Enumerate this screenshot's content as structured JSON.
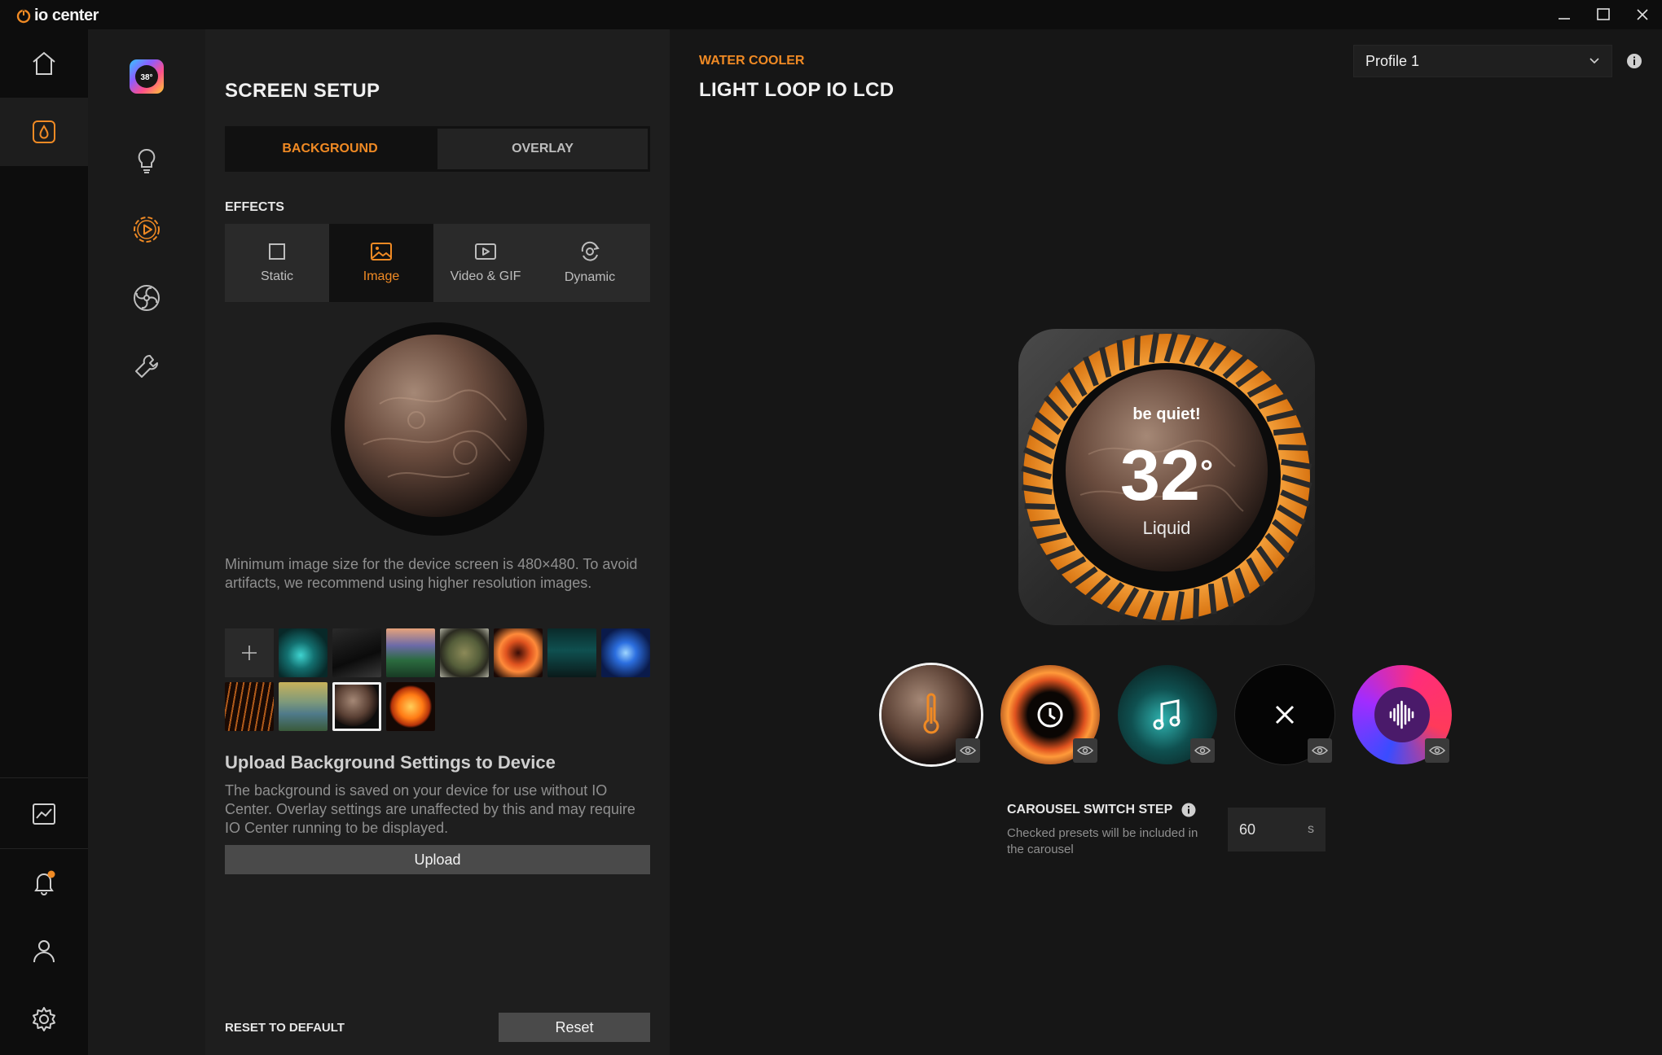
{
  "app": {
    "title": "io center"
  },
  "device": {
    "category": "WATER COOLER",
    "name": "LIGHT LOOP IO LCD"
  },
  "profile": {
    "selected": "Profile 1"
  },
  "panel": {
    "title": "SCREEN SETUP",
    "tabs": [
      {
        "label": "BACKGROUND",
        "active": true
      },
      {
        "label": "OVERLAY",
        "active": false
      }
    ],
    "effects_label": "EFFECTS",
    "effects": [
      {
        "label": "Static",
        "icon": "square-icon",
        "active": false
      },
      {
        "label": "Image",
        "icon": "image-icon",
        "active": true
      },
      {
        "label": "Video & GIF",
        "icon": "video-icon",
        "active": false
      },
      {
        "label": "Dynamic",
        "icon": "dynamic-icon",
        "active": false
      }
    ],
    "image_hint": "Minimum image size for the device screen is 480×480. To avoid artifacts, we recommend using higher resolution images.",
    "gallery": {
      "add_icon": "plus-icon",
      "thumbnails": [
        "cyan-room",
        "dark-corridor",
        "forest-sunset",
        "planet-green",
        "orange-swirl",
        "teal-lake",
        "blue-burst",
        "orange-lines",
        "mountain-lake",
        "brown-planet",
        "sun"
      ],
      "selected": "brown-planet"
    },
    "upload": {
      "heading": "Upload Background Settings to Device",
      "text": "The background is saved on your device for use without IO Center. Overlay settings are unaffected by this and may require IO Center running to be displayed.",
      "button": "Upload"
    },
    "reset": {
      "label": "RESET TO DEFAULT",
      "button": "Reset"
    }
  },
  "preview": {
    "brand": "be quiet!",
    "temperature": "32",
    "degree": "°",
    "sensor": "Liquid"
  },
  "presets": [
    {
      "name": "temperature",
      "icon": "thermometer-icon",
      "selected": true
    },
    {
      "name": "clock",
      "icon": "clock-icon",
      "selected": false
    },
    {
      "name": "music",
      "icon": "music-note-icon",
      "selected": false
    },
    {
      "name": "none",
      "icon": "close-icon",
      "selected": false
    },
    {
      "name": "audio",
      "icon": "audio-wave-icon",
      "selected": false
    }
  ],
  "carousel": {
    "label": "CAROUSEL SWITCH STEP",
    "hint": "Checked presets will be included in the carousel",
    "value": "60",
    "unit": "s"
  },
  "colors": {
    "accent": "#f08a24",
    "bg": "#161616",
    "panel": "#1e1e1e"
  }
}
